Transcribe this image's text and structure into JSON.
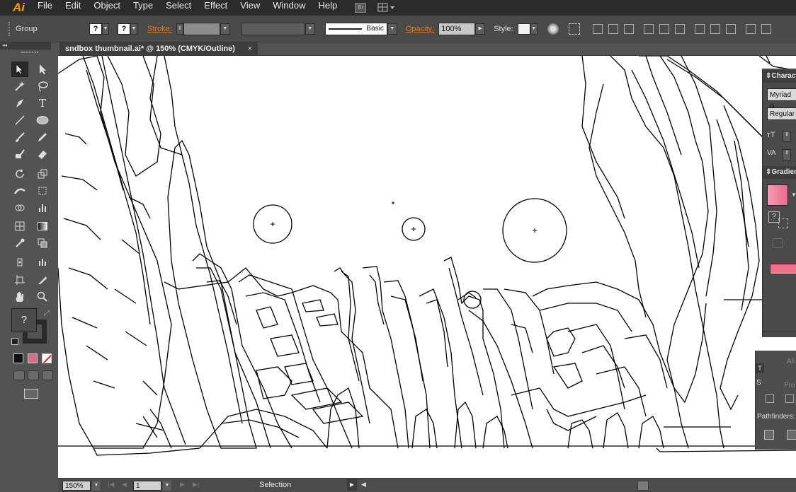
{
  "app": {
    "logo": "Ai"
  },
  "menu": [
    "File",
    "Edit",
    "Object",
    "Type",
    "Select",
    "Effect",
    "View",
    "Window",
    "Help"
  ],
  "menu_icons": {
    "bridge": "Br"
  },
  "control": {
    "selection_type": "Group",
    "stroke_label": "Stroke:",
    "brush_label": "Basic",
    "opacity_label": "Opacity:",
    "opacity_value": "100%",
    "style_label": "Style:",
    "fill_symbol": "?"
  },
  "tab": {
    "title": "sndbox thumbnail.ai* @ 150% (CMYK/Outline)",
    "close": "×"
  },
  "status": {
    "zoom": "150%",
    "artboard": "1",
    "tool": "Selection"
  },
  "panels": {
    "character": {
      "title": "Charact",
      "font": "Myriad P",
      "style": "Regular"
    },
    "gradient": {
      "title": "Gradien",
      "swatch_color": "#e86b8f",
      "bar_color": "#f0728f"
    },
    "lower": {
      "scale_label": "Sc",
      "align_label": "Ali",
      "pro_label": "Pro",
      "pathfinders": "Pathfinders:",
      "tab": "T",
      "side": "S"
    }
  },
  "tools_glyph": {
    "type": "T",
    "unknown_fill": "?"
  }
}
